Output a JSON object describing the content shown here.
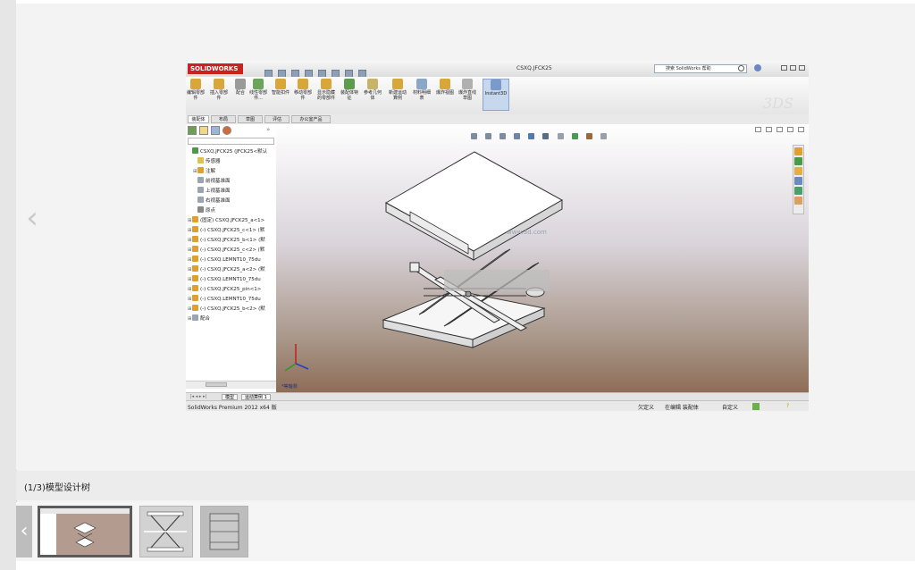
{
  "viewer": {
    "prev_arrow": "‹",
    "caption": "(1/3)模型设计树"
  },
  "thumbnails": {
    "prev_arrow": "‹",
    "items": [
      {
        "name": "thumb-1",
        "active": true
      },
      {
        "name": "thumb-2",
        "active": false
      },
      {
        "name": "thumb-3",
        "active": false
      }
    ]
  },
  "solidworks": {
    "logo": "SOLIDWORKS",
    "doc_title": "CSXQ.JFCK25",
    "search_placeholder": "搜索 SolidWorks 帮助",
    "ribbon": [
      {
        "label": "编辑零部件",
        "icon": "edit-component-icon"
      },
      {
        "label": "插入零部件",
        "icon": "insert-component-icon"
      },
      {
        "label": "配合",
        "icon": "mate-icon"
      },
      {
        "label": "线性零部件...",
        "icon": "linear-pattern-icon"
      },
      {
        "label": "智能扣件",
        "icon": "smart-fastener-icon"
      },
      {
        "label": "移动零部件",
        "icon": "move-component-icon"
      },
      {
        "label": "显示隐藏的零部件",
        "icon": "show-hidden-icon"
      },
      {
        "label": "装配体特征",
        "icon": "assembly-feature-icon"
      },
      {
        "label": "参考几何体",
        "icon": "reference-geometry-icon"
      },
      {
        "label": "新建运动算例",
        "icon": "new-motion-study-icon"
      },
      {
        "label": "材料明细表",
        "icon": "bill-of-materials-icon"
      },
      {
        "label": "爆炸视图",
        "icon": "exploded-view-icon"
      },
      {
        "label": "爆炸直线草图",
        "icon": "explode-line-sketch-icon"
      },
      {
        "label": "Instant3D",
        "icon": "instant3d-icon"
      }
    ],
    "tabs": [
      "装配体",
      "布局",
      "草图",
      "评估",
      "办公室产品"
    ],
    "tree": [
      {
        "text": "CSXQ.JFCK25  (JFCK25<默认",
        "prefix": ""
      },
      {
        "text": "传感器",
        "prefix": ""
      },
      {
        "text": "注解",
        "prefix": "⊞"
      },
      {
        "text": "前视基准面",
        "prefix": ""
      },
      {
        "text": "上视基准面",
        "prefix": ""
      },
      {
        "text": "右视基准面",
        "prefix": ""
      },
      {
        "text": "原点",
        "prefix": ""
      },
      {
        "text": "(固定) CSXQ.JFCK25_a<1>",
        "prefix": "⊞"
      },
      {
        "text": "(-) CSXQ.JFCK25_c<1> (默",
        "prefix": "⊞"
      },
      {
        "text": "(-) CSXQ.JFCK25_b<1> (默",
        "prefix": "⊞"
      },
      {
        "text": "(-) CSXQ.JFCK25_c<2> (默",
        "prefix": "⊞"
      },
      {
        "text": "(-) CSXQ.LEMNT10_75du",
        "prefix": "⊞"
      },
      {
        "text": "(-) CSXQ.JFCK25_a<2> (默",
        "prefix": "⊞"
      },
      {
        "text": "(-) CSXQ.LEMNT10_75du",
        "prefix": "⊞"
      },
      {
        "text": "(-) CSXQ.JFCK25_pin<1>",
        "prefix": "⊞"
      },
      {
        "text": "(-) CSXQ.LEMNT10_75du",
        "prefix": "⊞"
      },
      {
        "text": "(-) CSXQ.JFCK25_b<2> (默",
        "prefix": "⊞"
      },
      {
        "text": "配合",
        "prefix": "⊞"
      }
    ],
    "bottom_tabs": [
      "模型",
      "运动算例 1"
    ],
    "view_label": "*等轴测",
    "watermark": "www.3d.com",
    "status": {
      "left": "SolidWorks Premium 2012 x64 版",
      "under_defined": "欠定义",
      "editing": "在编辑 装配体",
      "custom": "自定义",
      "question": "?"
    }
  },
  "colors": {
    "accent_red": "#c8231f",
    "instant3d_bg": "#c7d7ee"
  }
}
